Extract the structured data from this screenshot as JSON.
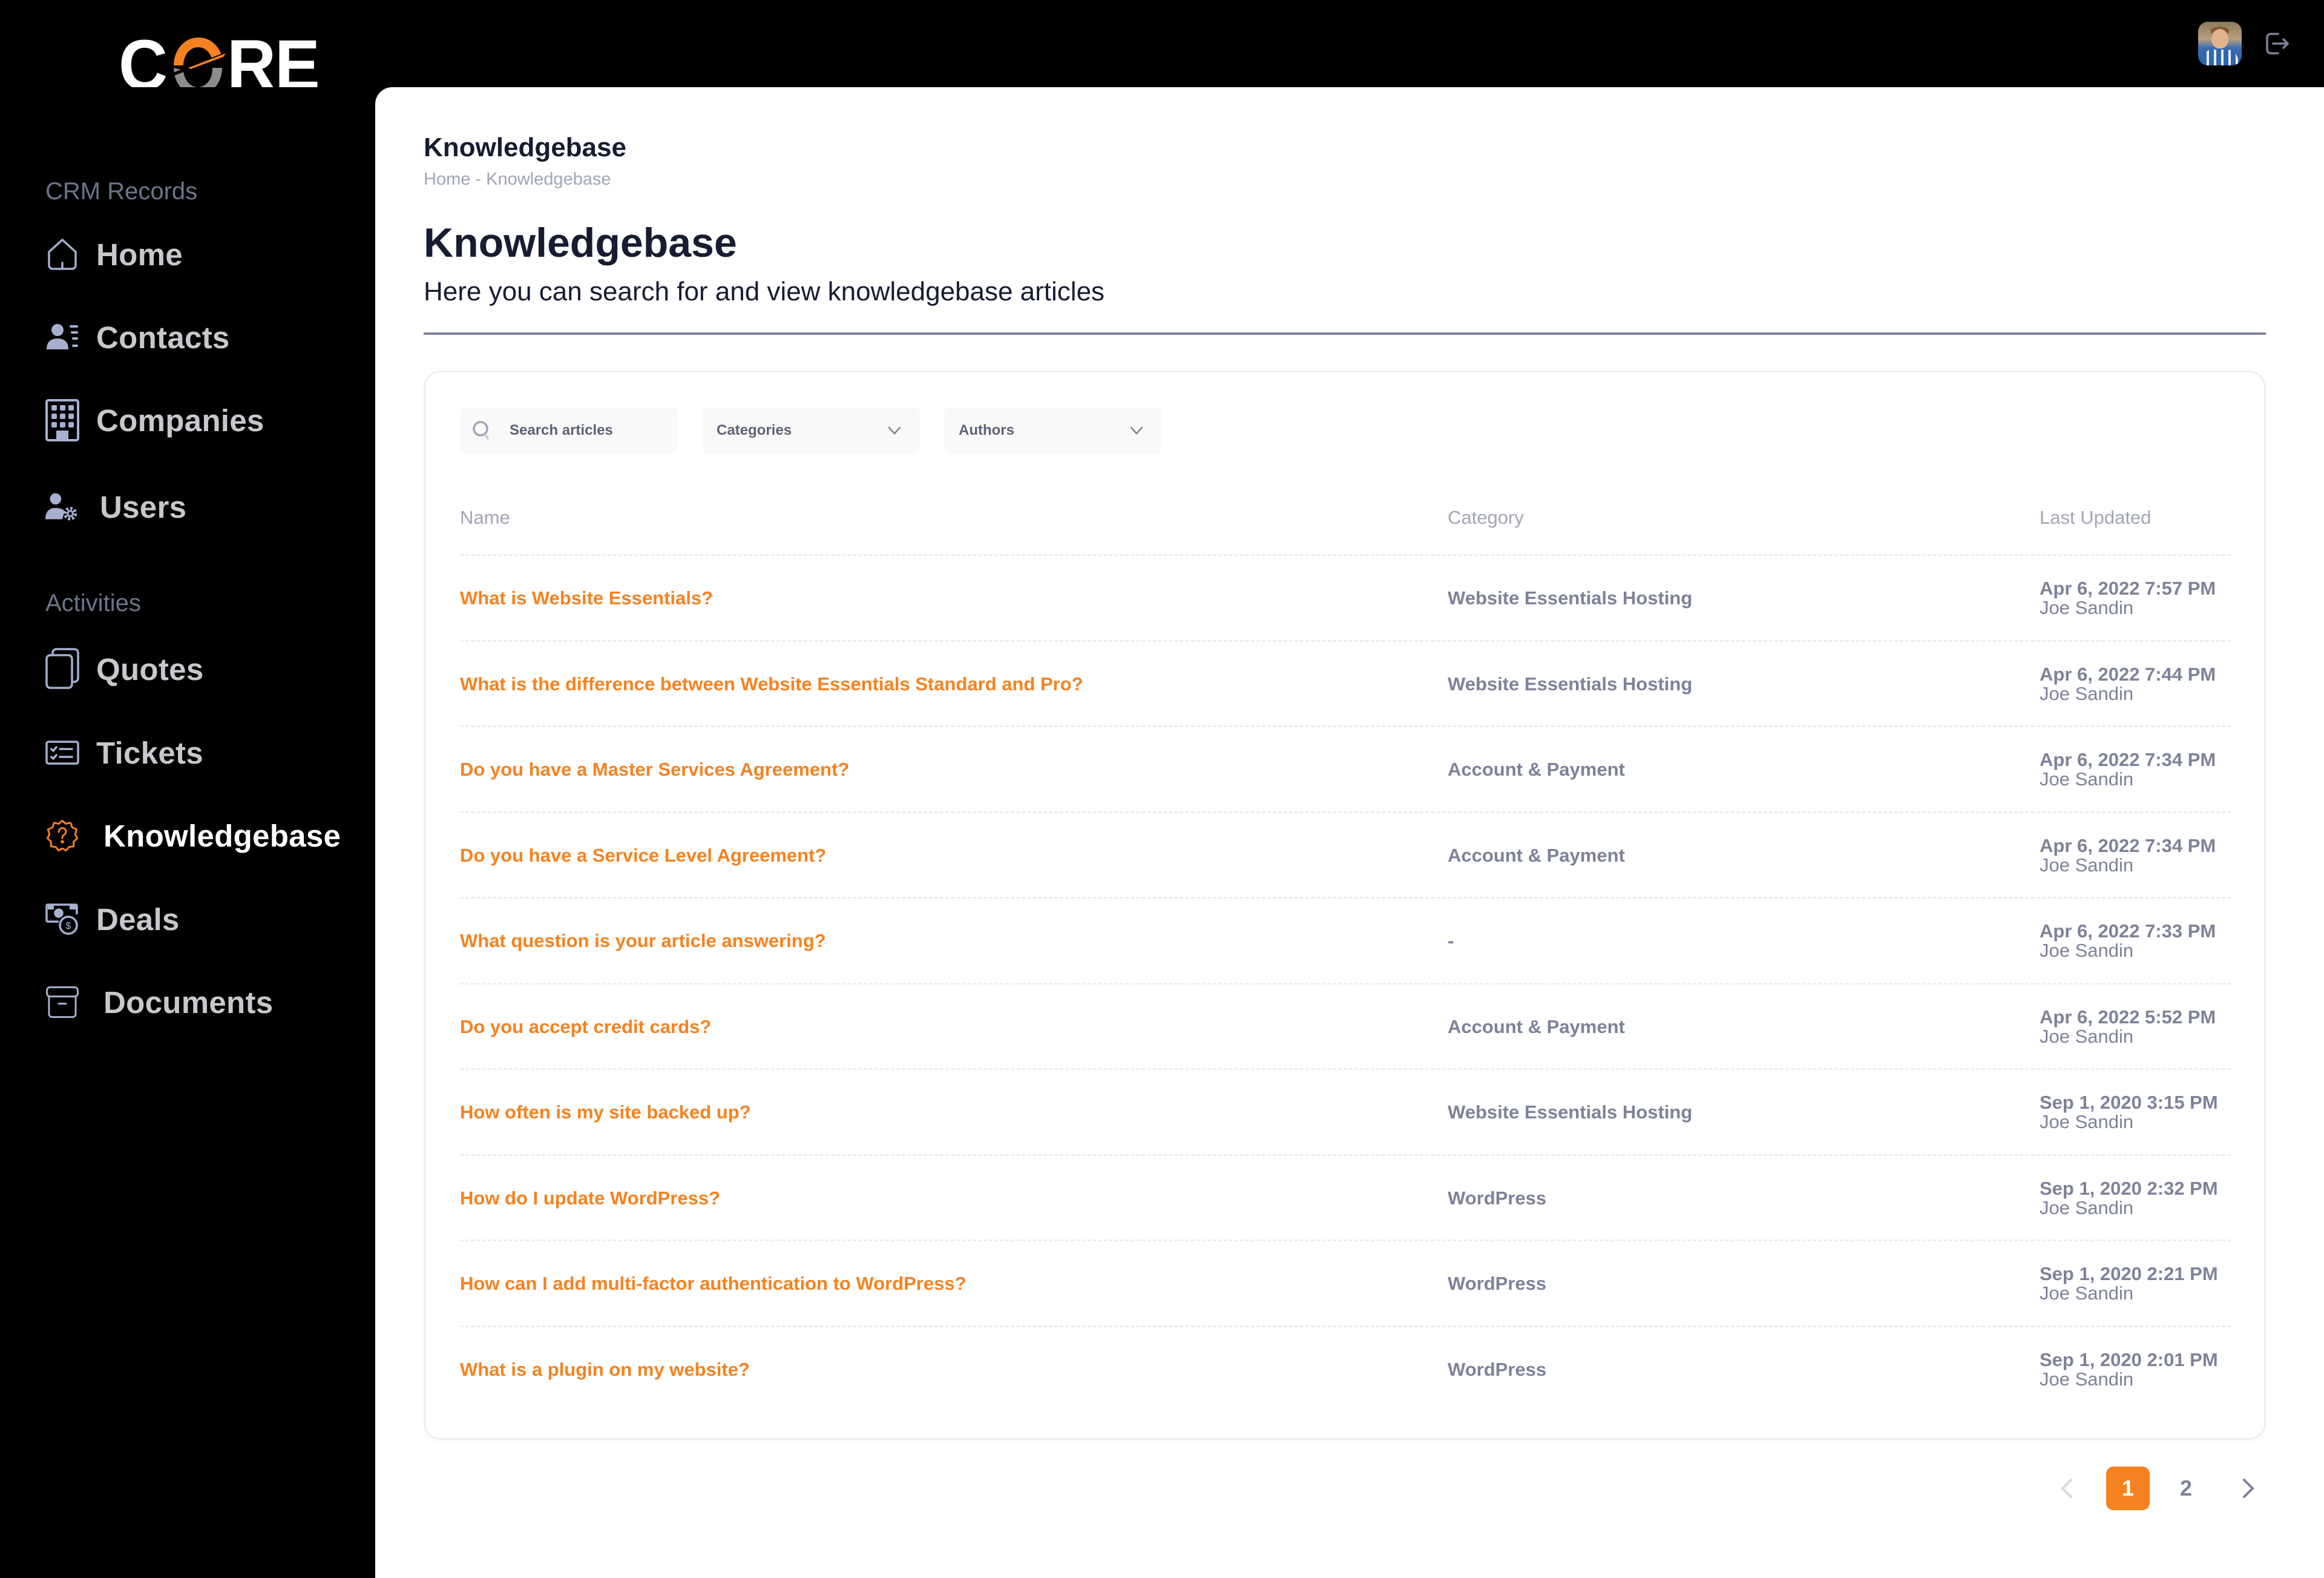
{
  "app": {
    "logo_text_left": "C",
    "logo_text_right": "RE",
    "brand_color": "#f58220"
  },
  "header": {
    "avatar_alt": "User avatar",
    "logout_icon": "logout-icon"
  },
  "sidebar": {
    "sections": [
      {
        "label": "CRM Records",
        "items": [
          {
            "label": "Home",
            "icon": "home-icon"
          },
          {
            "label": "Contacts",
            "icon": "contacts-icon"
          },
          {
            "label": "Companies",
            "icon": "building-icon"
          },
          {
            "label": "Users",
            "icon": "user-gear-icon"
          }
        ]
      },
      {
        "label": "Activities",
        "items": [
          {
            "label": "Quotes",
            "icon": "copy-icon"
          },
          {
            "label": "Tickets",
            "icon": "checklist-icon"
          },
          {
            "label": "Knowledgebase",
            "icon": "question-badge-icon",
            "active": true
          },
          {
            "label": "Deals",
            "icon": "money-icon"
          },
          {
            "label": "Documents",
            "icon": "archive-box-icon"
          }
        ]
      }
    ]
  },
  "toolbar": {
    "title": "Knowledgebase",
    "breadcrumb": "Home - Knowledgebase"
  },
  "page": {
    "title": "Knowledgebase",
    "subtitle": "Here you can search for and view knowledgebase articles"
  },
  "filters": {
    "search_placeholder": "Search articles",
    "categories_label": "Categories",
    "authors_label": "Authors"
  },
  "table": {
    "columns": [
      "Name",
      "Category",
      "Last Updated"
    ],
    "rows": [
      {
        "title": "What is Website Essentials?",
        "category": "Website Essentials Hosting",
        "date": "Apr 6, 2022 7:57 PM",
        "author": "Joe Sandin"
      },
      {
        "title": "What is the difference between Website Essentials Standard and Pro?",
        "category": "Website Essentials Hosting",
        "date": "Apr 6, 2022 7:44 PM",
        "author": "Joe Sandin"
      },
      {
        "title": "Do you have a Master Services Agreement?",
        "category": "Account & Payment",
        "date": "Apr 6, 2022 7:34 PM",
        "author": "Joe Sandin"
      },
      {
        "title": "Do you have a Service Level Agreement?",
        "category": "Account & Payment",
        "date": "Apr 6, 2022 7:34 PM",
        "author": "Joe Sandin"
      },
      {
        "title": "What question is your article answering?",
        "category": "-",
        "date": "Apr 6, 2022 7:33 PM",
        "author": "Joe Sandin"
      },
      {
        "title": "Do you accept credit cards?",
        "category": "Account & Payment",
        "date": "Apr 6, 2022 5:52 PM",
        "author": "Joe Sandin"
      },
      {
        "title": "How often is my site backed up?",
        "category": "Website Essentials Hosting",
        "date": "Sep 1, 2020 3:15 PM",
        "author": "Joe Sandin"
      },
      {
        "title": "How do I update WordPress?",
        "category": "WordPress",
        "date": "Sep 1, 2020 2:32 PM",
        "author": "Joe Sandin"
      },
      {
        "title": "How can I add multi-factor authentication to WordPress?",
        "category": "WordPress",
        "date": "Sep 1, 2020 2:21 PM",
        "author": "Joe Sandin"
      },
      {
        "title": "What is a plugin on my website?",
        "category": "WordPress",
        "date": "Sep 1, 2020 2:01 PM",
        "author": "Joe Sandin"
      }
    ]
  },
  "pagination": {
    "pages": [
      "1",
      "2"
    ],
    "current": "1"
  }
}
